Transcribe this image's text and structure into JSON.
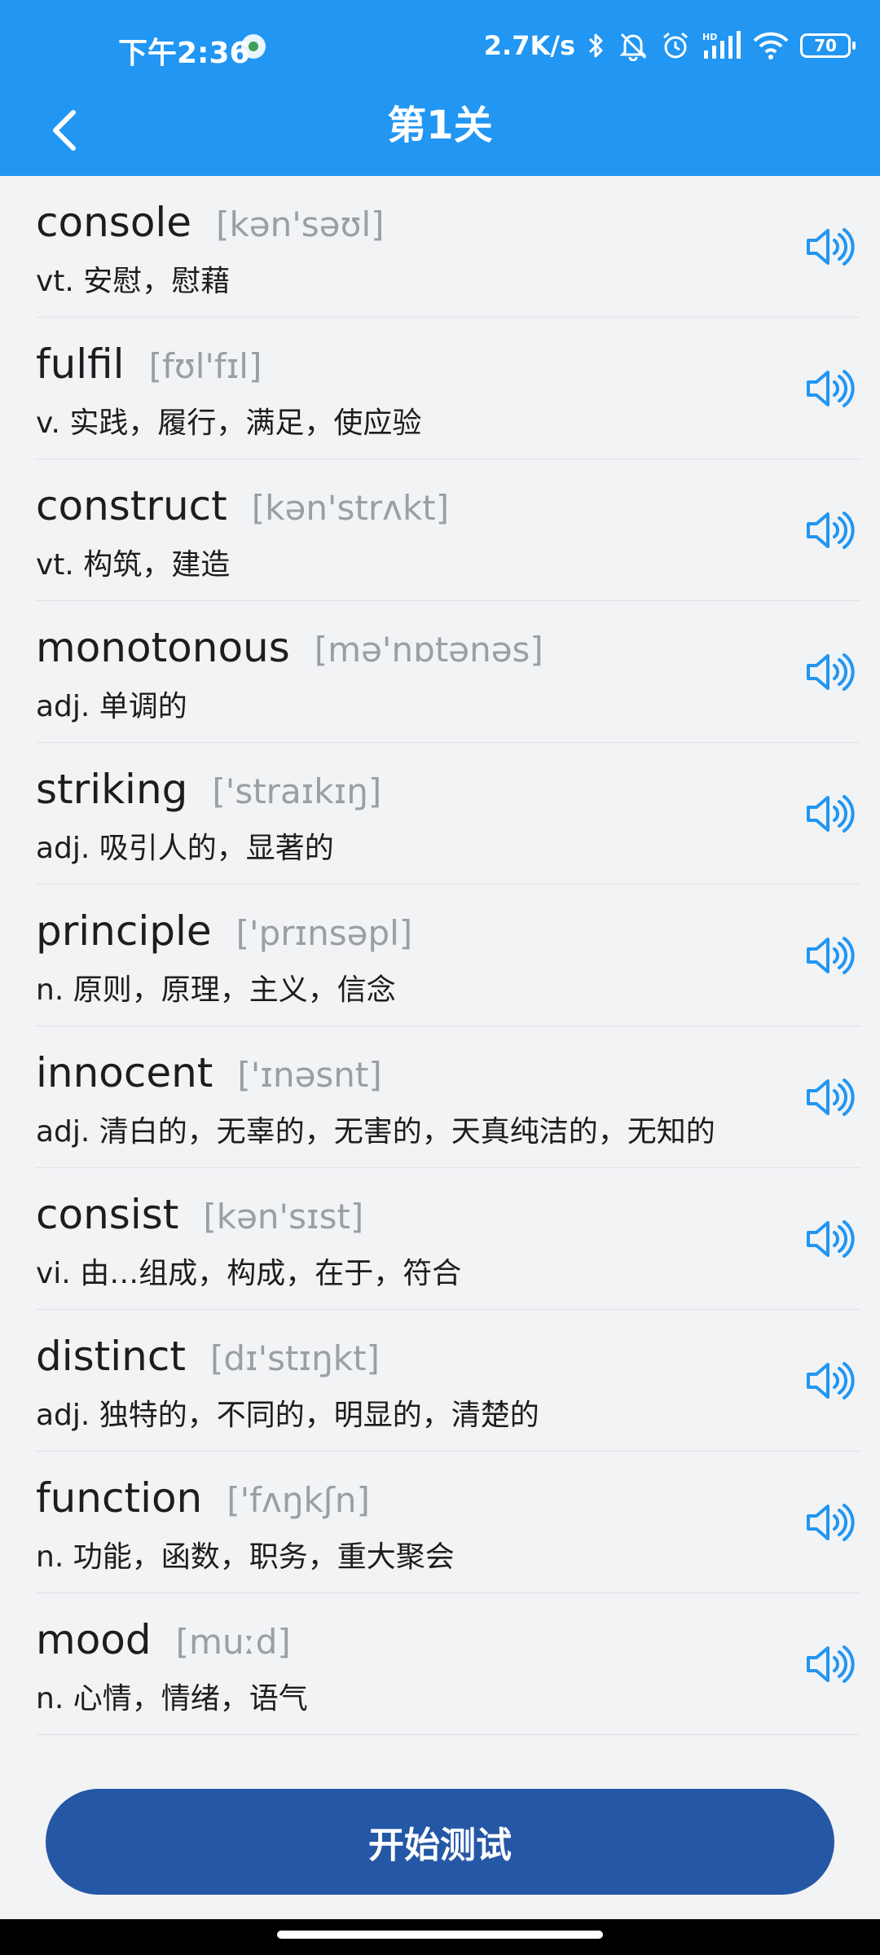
{
  "status_bar": {
    "time": "下午2:36",
    "net_speed": "2.7K/s",
    "battery": "70",
    "icons": [
      "app-notification-icon",
      "bluetooth-icon",
      "mute-bell-icon",
      "alarm-icon",
      "hd-signal-icon",
      "wifi-icon",
      "battery-icon"
    ]
  },
  "header": {
    "title": "第1关",
    "back_icon": "chevron-left-icon"
  },
  "words": [
    {
      "word": "console",
      "phonetic": "[kən'səʊl]",
      "meaning": "vt. 安慰，慰藉"
    },
    {
      "word": "fulfil",
      "phonetic": "[fʊl'fɪl]",
      "meaning": "v. 实践，履行，满足，使应验"
    },
    {
      "word": "construct",
      "phonetic": "[kən'strʌkt]",
      "meaning": "vt. 构筑，建造"
    },
    {
      "word": "monotonous",
      "phonetic": "[mə'nɒtənəs]",
      "meaning": "adj. 单调的"
    },
    {
      "word": "striking",
      "phonetic": "['straɪkɪŋ]",
      "meaning": "adj. 吸引人的，显著的"
    },
    {
      "word": "principle",
      "phonetic": "['prɪnsəpl]",
      "meaning": "n. 原则，原理，主义，信念"
    },
    {
      "word": "innocent",
      "phonetic": "['ɪnəsnt]",
      "meaning": "adj. 清白的，无辜的，无害的，天真纯洁的，无知的"
    },
    {
      "word": "consist",
      "phonetic": "[kən'sɪst]",
      "meaning": "vi. 由…组成，构成，在于，符合"
    },
    {
      "word": "distinct",
      "phonetic": "[dɪ'stɪŋkt]",
      "meaning": "adj. 独特的，不同的，明显的，清楚的"
    },
    {
      "word": "function",
      "phonetic": "['fʌŋkʃn]",
      "meaning": "n. 功能，函数，职务，重大聚会"
    },
    {
      "word": "mood",
      "phonetic": "[muːd]",
      "meaning": "n. 心情，情绪，语气"
    }
  ],
  "speaker_icon": "speaker-icon",
  "start_button": "开始测试",
  "colors": {
    "header": "#2196f3",
    "button": "#2557a7",
    "speaker": "#2196f3",
    "phonetic": "#9a9ea5"
  }
}
